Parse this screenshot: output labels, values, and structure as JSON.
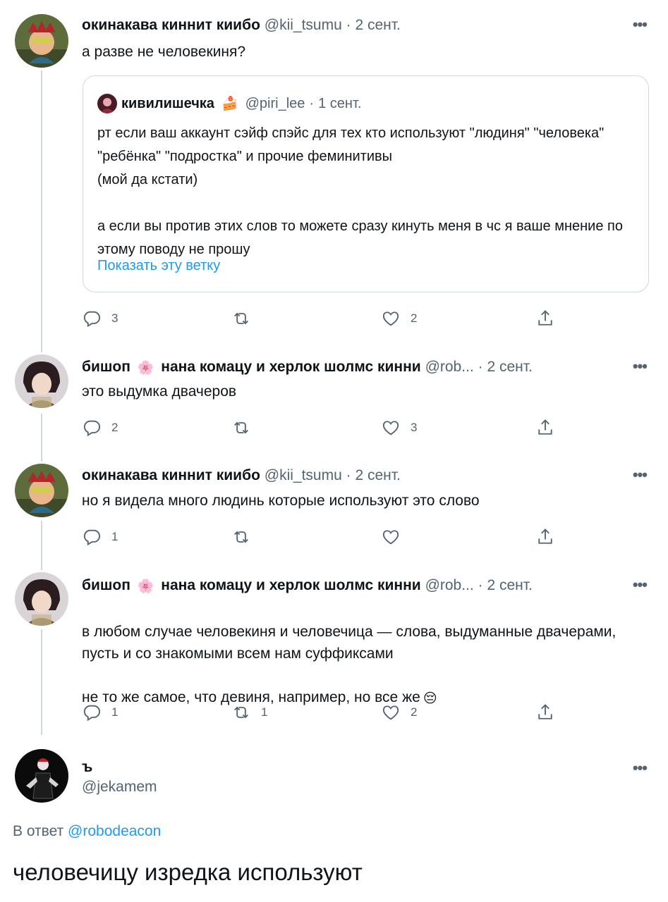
{
  "tweets": [
    {
      "name": "окинакава киннит киибо",
      "handle": "@kii_tsumu",
      "date": "2 сент.",
      "text": "а разве не человекиня?",
      "quote": {
        "name": "кивилишечка",
        "emoji": "🍰",
        "handle": "@piri_lee",
        "date": "1 сент.",
        "text": "рт если ваш аккаунт сэйф спэйс для тех кто используют \"людиня\" \"человека\" \"ребёнка\" \"подростка\" и прочие феминитивы\n(мой да кстати)\n\nа если вы против этих слов то можете сразу кинуть меня в чс я ваше мнение по этому поводу не прошу",
        "show_thread": "Показать эту ветку"
      },
      "replies": "3",
      "retweets": "",
      "likes": "2"
    },
    {
      "name": "бишоп",
      "emoji": "🌸",
      "name2": "нана комацу и херлок шолмс кинни",
      "handle": "@rob...",
      "date": "2 сент.",
      "text": "это выдумка двачеров",
      "replies": "2",
      "retweets": "",
      "likes": "3"
    },
    {
      "name": "окинакава киннит киибо",
      "handle": "@kii_tsumu",
      "date": "2 сент.",
      "text": "но я видела много людинь которые используют это слово",
      "replies": "1",
      "retweets": "",
      "likes": ""
    },
    {
      "name": "бишоп",
      "emoji": "🌸",
      "name2": "нана комацу и херлок шолмс кинни",
      "handle": "@rob...",
      "date": "2 сент.",
      "text": "в любом случае человекиня и человечица — слова, выдуманные двачерами, пусть и со знакомыми всем нам суффиксами\n\nне то же самое, что девиня, например, но все же",
      "text_emoji": "😔",
      "replies": "1",
      "retweets": "1",
      "likes": "2"
    }
  ],
  "main": {
    "name": "ъ",
    "handle": "@jekamem",
    "reply_prefix": "В ответ",
    "reply_link": "@robodeacon",
    "text": "человечицу изредка используют"
  },
  "ui": {
    "more": "•••",
    "separator": "·"
  },
  "icons": {
    "reply": "reply-icon",
    "retweet": "retweet-icon",
    "like": "heart-icon",
    "share": "share-icon",
    "more": "more-icon"
  },
  "colors": {
    "text": "#0f1419",
    "secondary": "#536471",
    "link": "#1d9bf0",
    "border": "#cfd9de"
  }
}
